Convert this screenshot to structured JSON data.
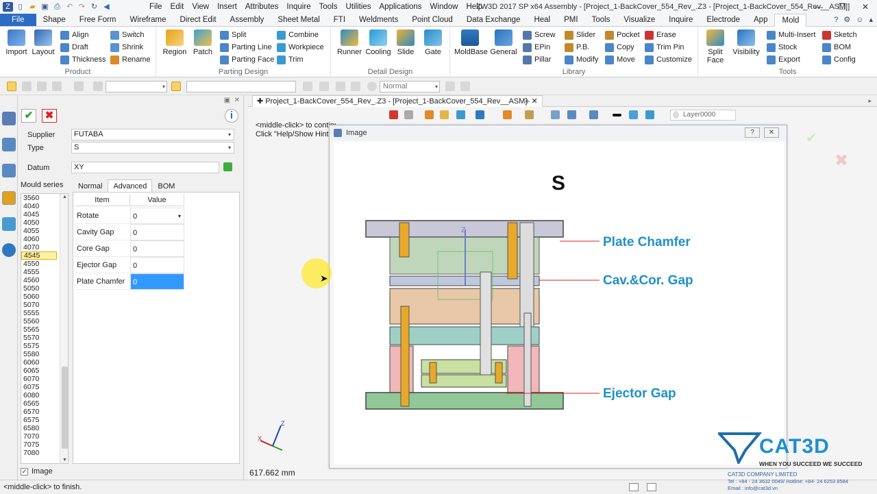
{
  "menubar": [
    "File",
    "Edit",
    "View",
    "Insert",
    "Attributes",
    "Inquire",
    "Tools",
    "Utilities",
    "Applications",
    "Window",
    "Help"
  ],
  "app_title": "ZW3D 2017 SP x64          Assembly - [Project_1-BackCover_554_Rev_.Z3 - [Project_1-BackCover_554_Rev__ASM]]",
  "ribbon_tabs": [
    "File",
    "Shape",
    "Free Form",
    "Wireframe",
    "Direct Edit",
    "Assembly",
    "Sheet Metal",
    "FTI",
    "Weldments",
    "Point Cloud",
    "Data Exchange",
    "Heal",
    "PMI",
    "Tools",
    "Visualize",
    "Inquire",
    "Electrode",
    "App",
    "Mold"
  ],
  "ribbon": {
    "product": {
      "label": "Product",
      "import": "Import",
      "layout": "Layout",
      "align": "Align",
      "draft": "Draft",
      "thickness": "Thickness",
      "switch": "Switch",
      "shrink": "Shrink",
      "rename": "Rename"
    },
    "parting": {
      "label": "Parting Design",
      "region": "Region",
      "patch": "Patch",
      "split": "Split",
      "parting_line": "Parting Line",
      "parting_face": "Parting Face",
      "combine": "Combine",
      "workpiece": "Workpiece",
      "trim": "Trim"
    },
    "detail": {
      "label": "Detail Design",
      "runner": "Runner",
      "cooling": "Cooling",
      "slide": "Slide",
      "gate": "Gate"
    },
    "library": {
      "label": "Library",
      "moldbase": "MoldBase",
      "general": "General",
      "screw": "Screw",
      "epin": "EPin",
      "pillar": "Pillar",
      "slider": "Slider",
      "pb": "P.B.",
      "modify": "Modify",
      "pocket": "Pocket",
      "copy": "Copy",
      "move": "Move",
      "erase": "Erase",
      "trim_pin": "Trim Pin",
      "customize": "Customize"
    },
    "tools": {
      "label": "Tools",
      "split_face": "Split Face",
      "visibility": "Visibility",
      "multi_insert": "Multi-Insert",
      "stock": "Stock",
      "export": "Export",
      "sketch": "Sketch",
      "bom": "BOM",
      "config": "Config"
    }
  },
  "toolbar": {
    "filter_value": "Normal"
  },
  "panel": {
    "supplier_label": "Supplier",
    "supplier_value": "FUTABA",
    "type_label": "Type",
    "type_value": "S",
    "datum_label": "Datum",
    "datum_value": "XY",
    "series_label": "Mould series",
    "tabs": [
      "Normal",
      "Advanced",
      "BOM"
    ],
    "series": [
      "3560",
      "4040",
      "4045",
      "4050",
      "4055",
      "4060",
      "4070",
      "4545",
      "4550",
      "4555",
      "4560",
      "5050",
      "5060",
      "5070",
      "5555",
      "5560",
      "5565",
      "5570",
      "5575",
      "5580",
      "6060",
      "6065",
      "6070",
      "6075",
      "6080",
      "6565",
      "6570",
      "6575",
      "6580",
      "7070",
      "7075",
      "7080"
    ],
    "selected_series": "4545",
    "table_headers": [
      "Item",
      "Value"
    ],
    "rows": [
      {
        "item": "Rotate",
        "value": "0"
      },
      {
        "item": "Cavity Gap",
        "value": "0"
      },
      {
        "item": "Core Gap",
        "value": "0"
      },
      {
        "item": "Ejector Gap",
        "value": "0"
      },
      {
        "item": "Plate Chamfer",
        "value": "0"
      }
    ],
    "image_checkbox": "Image"
  },
  "viewport": {
    "doc_tab": "Project_1-BackCover_554_Rev_.Z3 - [Project_1-BackCover_554_Rev__ASM]",
    "layer": "Layer0000",
    "hint_line1": "<middle-click> to continue.",
    "hint_line2": "Click \"Help/Show Hints\"",
    "distance": "617.662 mm"
  },
  "dialog": {
    "title": "Image",
    "type_letter": "S",
    "callouts": [
      "Plate Chamfer",
      "Cav.&Cor. Gap",
      "Ejector Gap"
    ]
  },
  "status": "<middle-click> to finish.",
  "watermark": {
    "brand": "CAT3D",
    "slogan": "WHEN YOU SUCCEED WE SUCCEED",
    "company": "CAT3D COMPANY LIMITED",
    "tel": "Tel : +84 - 24 3632 0049/ Hotline: +84- 24 6253 8584",
    "email": "Email : info@cat3d.vn"
  },
  "colors": {
    "file_tab": "#2b6cc4",
    "selection": "#3399ff",
    "callout": "#1e90c8",
    "accent_red": "#e02020"
  }
}
